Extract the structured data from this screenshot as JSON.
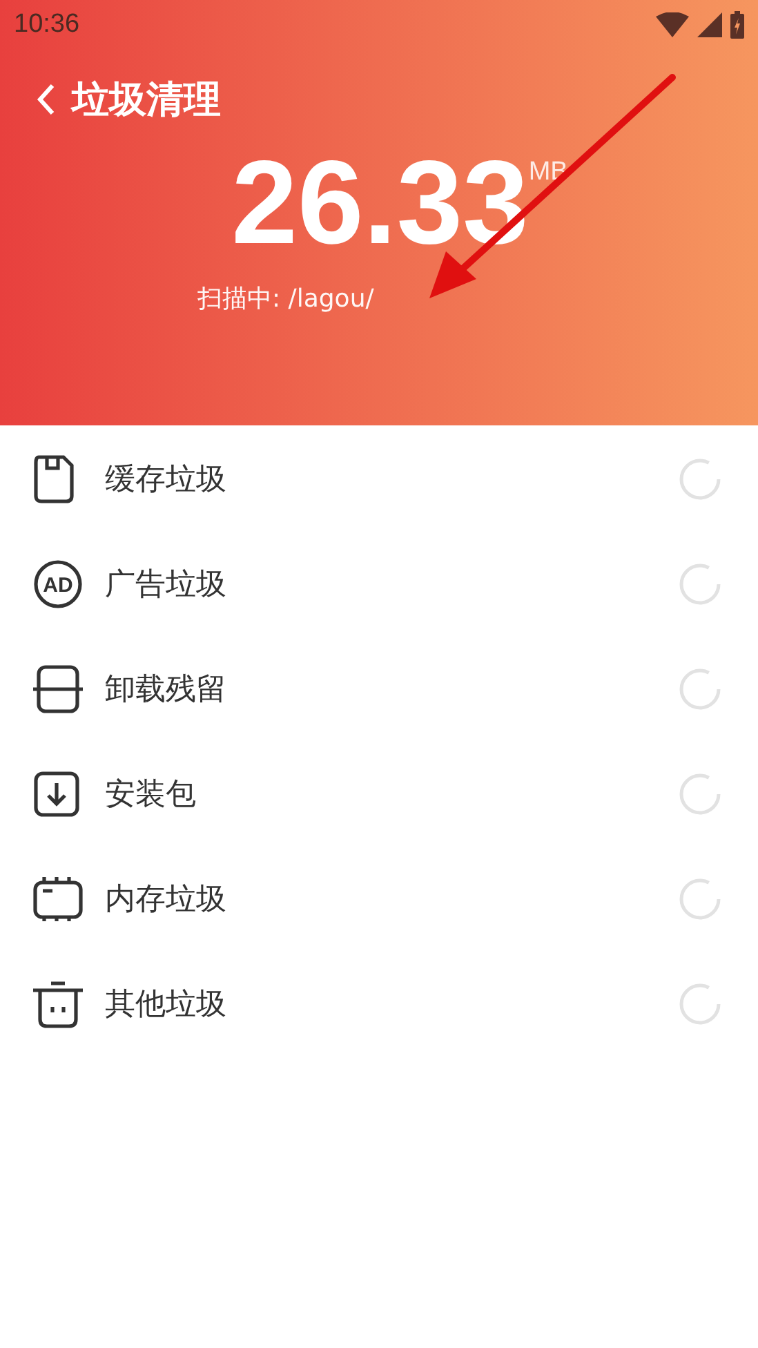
{
  "status_bar": {
    "time": "10:36"
  },
  "header": {
    "title": "垃圾清理",
    "size": "26.33",
    "unit": "MB",
    "scan_label": "扫描中: /lagou/"
  },
  "categories": [
    {
      "kind": "cache",
      "label": "缓存垃圾",
      "scanning": true
    },
    {
      "kind": "ad",
      "label": "广告垃圾",
      "icon_text": "AD",
      "scanning": true
    },
    {
      "kind": "uninstall",
      "label": "卸载残留",
      "scanning": true
    },
    {
      "kind": "package",
      "label": "安装包",
      "scanning": true
    },
    {
      "kind": "memory",
      "label": "内存垃圾",
      "scanning": true
    },
    {
      "kind": "other",
      "label": "其他垃圾",
      "scanning": true
    }
  ]
}
